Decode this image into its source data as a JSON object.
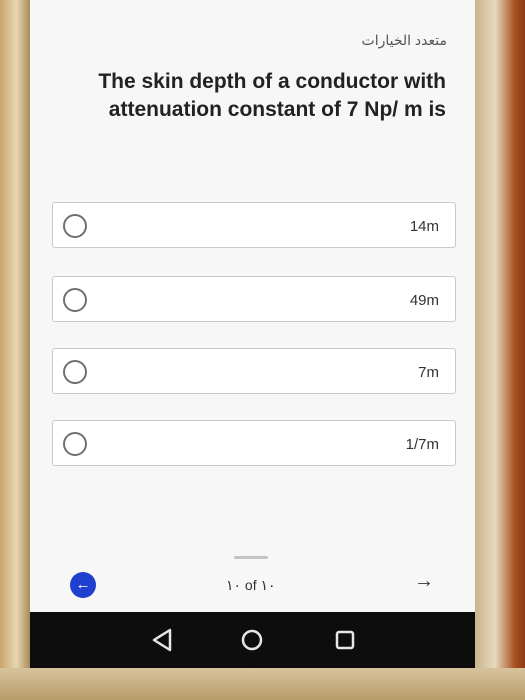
{
  "header": {
    "label": "متعدد الخيارات"
  },
  "question": {
    "text": "The skin depth of a conductor with attenuation constant of 7 Np/ m is"
  },
  "options": [
    {
      "label": "14m"
    },
    {
      "label": "49m"
    },
    {
      "label": "7m"
    },
    {
      "label": "1/7m"
    }
  ],
  "footer": {
    "progress": "١٠ of ١٠",
    "back_icon": "arrow-left",
    "next_icon": "arrow-right"
  },
  "navbar": {
    "icons": [
      "back-triangle",
      "home-circle",
      "recent-square"
    ]
  }
}
